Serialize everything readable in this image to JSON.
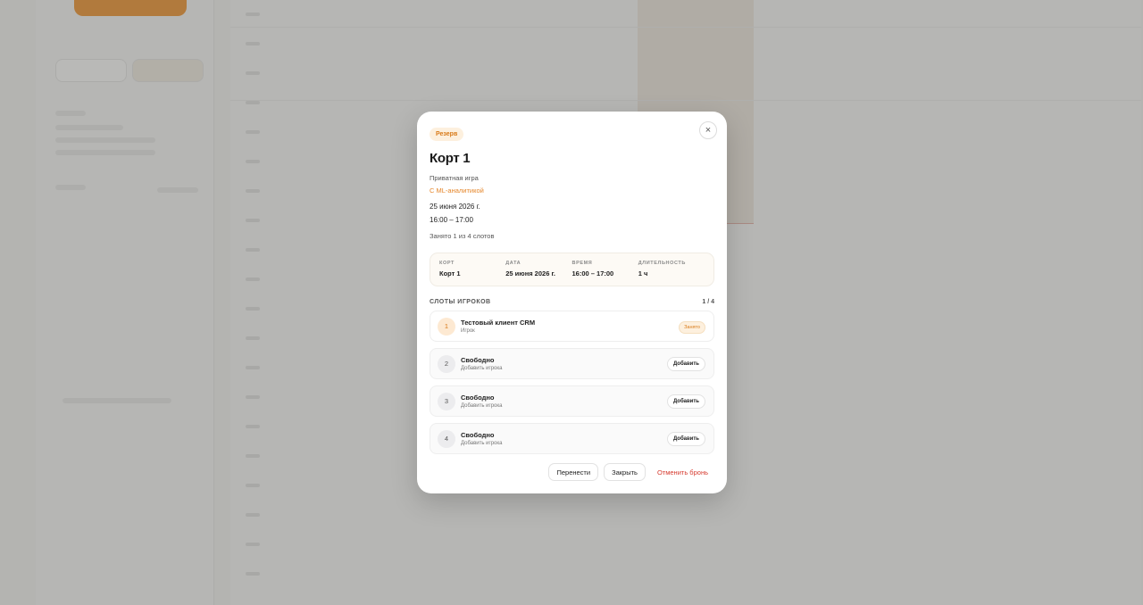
{
  "modal": {
    "badge": "Резерв",
    "title": "Корт 1",
    "subtitle": "Приватная игра",
    "ml_link": "С ML-аналитикой",
    "date": "25 июня 2026 г.",
    "time": "16:00 – 17:00",
    "occupied": "Занято 1 из 4 слотов",
    "close_icon": "×",
    "info": [
      {
        "label": "Корт",
        "value": "Корт 1"
      },
      {
        "label": "Дата",
        "value": "25 июня 2026 г."
      },
      {
        "label": "Время",
        "value": "16:00 – 17:00"
      },
      {
        "label": "Длительность",
        "value": "1 ч"
      }
    ],
    "slots_title": "Слоты игроков",
    "slots_count": "1 / 4",
    "slots": [
      {
        "num": "1",
        "name": "Тестовый клиент CRM",
        "sub": "Игрок",
        "tag": "Занято"
      },
      {
        "num": "2",
        "name": "Свободно",
        "sub": "Добавить игрока",
        "action": "Добавить"
      },
      {
        "num": "3",
        "name": "Свободно",
        "sub": "Добавить игрока",
        "action": "Добавить"
      },
      {
        "num": "4",
        "name": "Свободно",
        "sub": "Добавить игрока",
        "action": "Добавить"
      }
    ],
    "footer": {
      "reschedule": "Перенести",
      "close": "Закрыть",
      "cancel": "Отменить бронь"
    }
  },
  "colors": {
    "accent": "#e5862a",
    "danger": "#d63a2e",
    "badge_bg": "#fdf0de"
  }
}
